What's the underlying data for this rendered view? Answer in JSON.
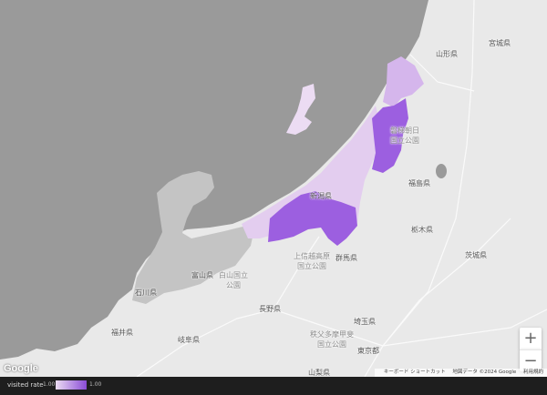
{
  "map": {
    "colors": {
      "sea": "#9a9a9a",
      "land": "#e9e9e9",
      "unvisited_dim": "#c4c4c4",
      "low": "#ecdcf3",
      "mid": "#d5b6ec",
      "high": "#9c5fe0"
    },
    "prefecture_labels": {
      "yamagata": "山形県",
      "miyagi": "宮城県",
      "fukushima": "福島県",
      "tochigi": "栃木県",
      "ibaraki": "茨城県",
      "gunma": "群馬県",
      "saitama": "埼玉県",
      "tokyo": "東京都",
      "yamanashi": "山梨県",
      "nagano": "長野県",
      "gifu": "岐阜県",
      "fukui": "福井県",
      "ishikawa": "石川県",
      "toyama": "富山県",
      "niigata": "新潟県"
    },
    "park_labels": {
      "joshinetsu": "上信越高原\n国立公園",
      "chichibu": "秩父多摩甲斐\n国立公園",
      "hakusan": "白山国立\n公園",
      "bandai": "磐梯朝日\n国立公園"
    },
    "visited": [
      {
        "name": "niigata-north",
        "level": "mid"
      },
      {
        "name": "niigata-east",
        "level": "high"
      },
      {
        "name": "niigata-south",
        "level": "high"
      },
      {
        "name": "sado-island",
        "level": "low"
      }
    ],
    "zoom_in": "+",
    "zoom_out": "−",
    "google_logo": "Google",
    "attribution": {
      "shortcuts": "キーボード ショートカット",
      "data": "地図データ ©2024 Google",
      "terms": "利用規約"
    }
  },
  "legend": {
    "title": "visited rate",
    "min": "1.00",
    "max": "1.00"
  }
}
